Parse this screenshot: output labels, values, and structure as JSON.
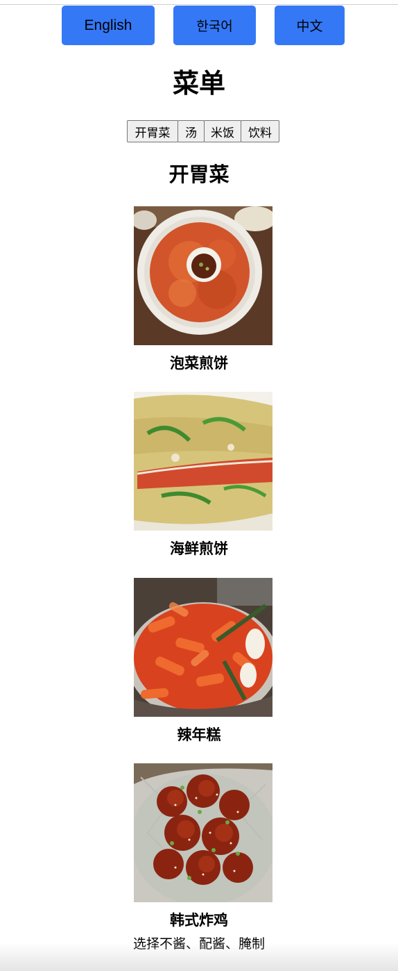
{
  "language_switcher": {
    "english": "English",
    "korean": "한국어",
    "chinese": "中文",
    "button_color": "#3478f6"
  },
  "page_title": "菜单",
  "category_tabs": [
    {
      "label": "开胃菜"
    },
    {
      "label": "汤"
    },
    {
      "label": "米饭"
    },
    {
      "label": "饮料"
    }
  ],
  "section_title": "开胃菜",
  "dishes": [
    {
      "name": "泡菜煎饼",
      "photo": "kimchi-pancake-photo"
    },
    {
      "name": "海鲜煎饼",
      "photo": "seafood-pancake-photo"
    },
    {
      "name": "辣年糕",
      "photo": "tteokbokki-photo"
    },
    {
      "name": "韩式炸鸡",
      "description": "选择不酱、配酱、腌制",
      "photo": "korean-fried-chicken-photo"
    }
  ]
}
